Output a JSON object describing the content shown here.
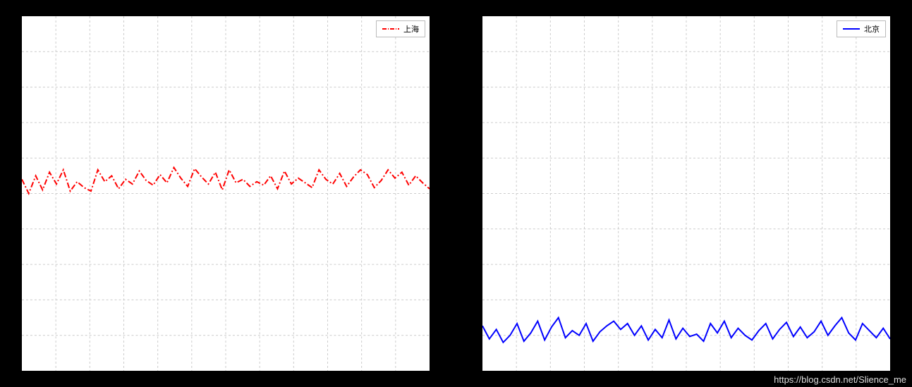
{
  "watermark": "https://blog.csdn.net/Slience_me",
  "chart_data": [
    {
      "type": "line",
      "series": [
        {
          "name": "上海",
          "color": "#ff0000",
          "linestyle": "dashdot",
          "values": [
            16.2,
            15.0,
            16.5,
            15.3,
            16.8,
            15.8,
            17.0,
            15.2,
            16.0,
            15.5,
            15.2,
            17.0,
            16.0,
            16.5,
            15.4,
            16.2,
            15.8,
            16.9,
            16.1,
            15.7,
            16.6,
            15.9,
            17.2,
            16.3,
            15.6,
            17.1,
            16.4,
            15.8,
            16.8,
            15.3,
            17.0,
            15.9,
            16.2,
            15.6,
            16.0,
            15.7,
            16.5,
            15.4,
            16.9,
            15.8,
            16.3,
            15.9,
            15.5,
            17.0,
            16.2,
            15.8,
            16.7,
            15.6,
            16.4,
            17.0,
            16.6,
            15.5,
            16.1,
            17.0,
            16.3,
            16.8,
            15.7,
            16.5,
            15.9,
            15.4
          ]
        }
      ],
      "x": [
        0,
        1,
        2,
        3,
        4,
        5,
        6,
        7,
        8,
        9,
        10,
        11,
        12,
        13,
        14,
        15,
        16,
        17,
        18,
        19,
        20,
        21,
        22,
        23,
        24,
        25,
        26,
        27,
        28,
        29,
        30,
        31,
        32,
        33,
        34,
        35,
        36,
        37,
        38,
        39,
        40,
        41,
        42,
        43,
        44,
        45,
        46,
        47,
        48,
        49,
        50,
        51,
        52,
        53,
        54,
        55,
        56,
        57,
        58,
        59
      ],
      "xlim": [
        0,
        59
      ],
      "ylim": [
        0,
        30
      ],
      "grid": true,
      "legend_position": "upper right"
    },
    {
      "type": "line",
      "series": [
        {
          "name": "北京",
          "color": "#0000ff",
          "linestyle": "solid",
          "values": [
            3.8,
            2.7,
            3.5,
            2.4,
            3.0,
            4.0,
            2.5,
            3.2,
            4.2,
            2.6,
            3.7,
            4.5,
            2.8,
            3.4,
            3.0,
            4.0,
            2.5,
            3.3,
            3.8,
            4.2,
            3.5,
            4.0,
            3.0,
            3.8,
            2.6,
            3.5,
            2.8,
            4.3,
            2.7,
            3.6,
            2.9,
            3.1,
            2.5,
            4.0,
            3.2,
            4.2,
            2.8,
            3.6,
            3.0,
            2.6,
            3.4,
            4.0,
            2.7,
            3.5,
            4.1,
            2.9,
            3.7,
            2.8,
            3.3,
            4.2,
            3.0,
            3.8,
            4.5,
            3.2,
            2.6,
            4.0,
            3.4,
            2.8,
            3.6,
            2.7
          ]
        }
      ],
      "x": [
        0,
        1,
        2,
        3,
        4,
        5,
        6,
        7,
        8,
        9,
        10,
        11,
        12,
        13,
        14,
        15,
        16,
        17,
        18,
        19,
        20,
        21,
        22,
        23,
        24,
        25,
        26,
        27,
        28,
        29,
        30,
        31,
        32,
        33,
        34,
        35,
        36,
        37,
        38,
        39,
        40,
        41,
        42,
        43,
        44,
        45,
        46,
        47,
        48,
        49,
        50,
        51,
        52,
        53,
        54,
        55,
        56,
        57,
        58,
        59
      ],
      "xlim": [
        0,
        59
      ],
      "ylim": [
        0,
        30
      ],
      "grid": true,
      "legend_position": "upper right"
    }
  ]
}
